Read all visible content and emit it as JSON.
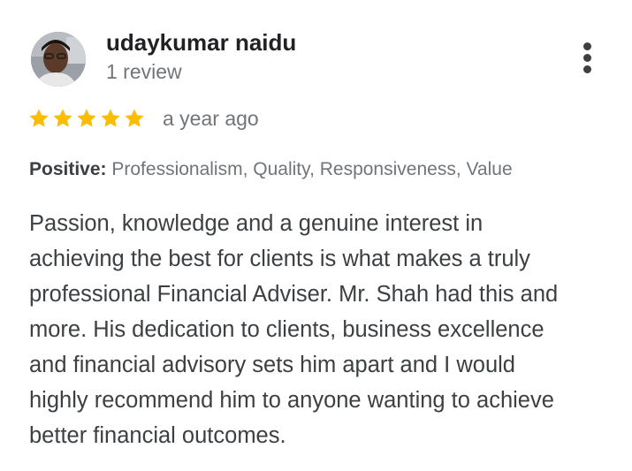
{
  "review": {
    "author": {
      "name": "udaykumar naidu",
      "review_count": "1 review",
      "avatar_icon": "profile-photo"
    },
    "rating": {
      "stars": 5,
      "max_stars": 5,
      "star_color": "#fbbc04",
      "star_icon": "star-icon"
    },
    "date": "a year ago",
    "attributes": {
      "label": "Positive:",
      "values": "Professionalism, Quality, Responsiveness, Value"
    },
    "text": "Passion, knowledge and a genuine interest in\nachieving the best for clients is what makes a truly\nprofessional Financial Adviser. Mr. Shah had this and\nmore. His dedication to clients, business excellence\nand financial advisory sets him apart and I would\nhighly recommend him to anyone wanting to achieve\nbetter financial outcomes.",
    "menu_icon": "more-vert-icon"
  }
}
